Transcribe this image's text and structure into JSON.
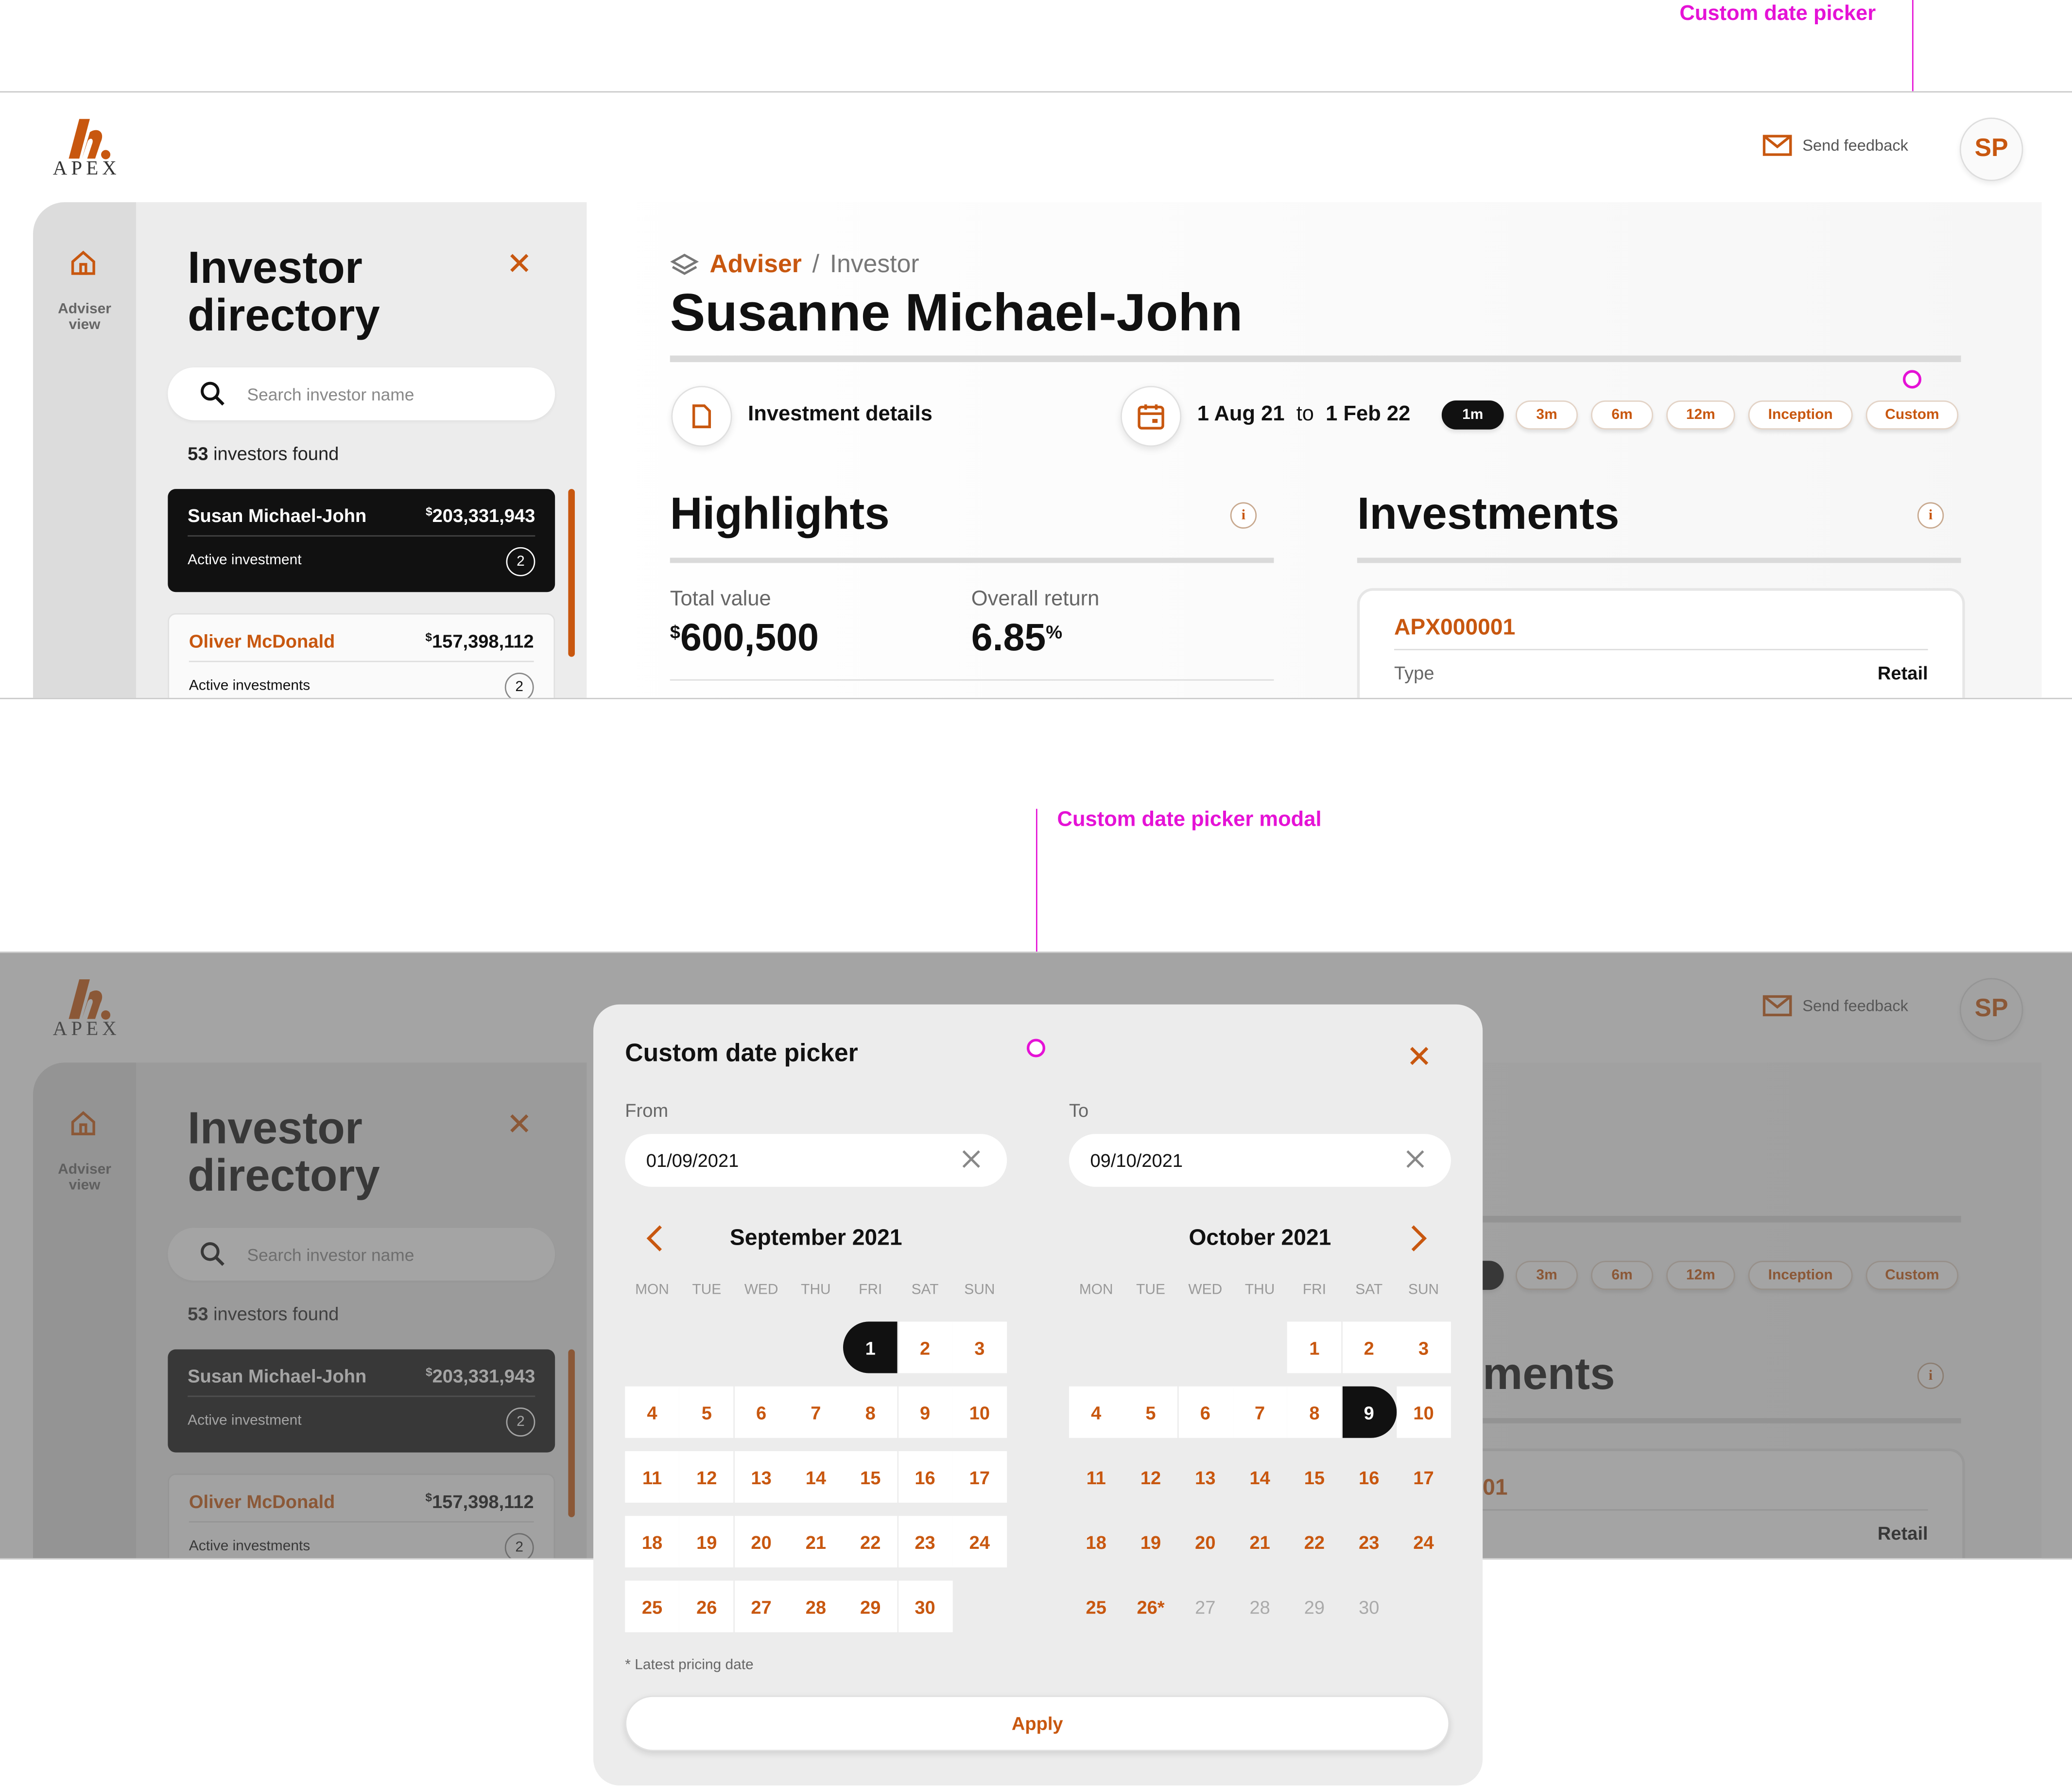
{
  "annotations": {
    "top": "Custom date picker",
    "bottom": "Custom date picker modal"
  },
  "brand": {
    "logo_text": "APEX",
    "accent": "#c8570f"
  },
  "header": {
    "feedback_label": "Send feedback",
    "avatar_initials": "SP"
  },
  "rail": {
    "home_label": "Adviser view"
  },
  "directory": {
    "title": "Investor directory",
    "search_placeholder": "Search investor name",
    "found_count": "53",
    "found_suffix": " investors found",
    "investors": [
      {
        "name": "Susan Michael-John",
        "currency": "$",
        "amount": "203,331,943",
        "status": "Active investment",
        "count": "2"
      },
      {
        "name": "Oliver McDonald",
        "currency": "$",
        "amount": "157,398,112",
        "status": "Active investments",
        "count": "2"
      }
    ]
  },
  "main": {
    "breadcrumb": {
      "adviser": "Adviser",
      "separator": "/",
      "investor": "Investor"
    },
    "investor_name": "Susanne Michael-John",
    "investment_details_label": "Investment details",
    "date_range": {
      "from": "1 Aug 21",
      "to_word": "to",
      "to": "1 Feb 22"
    },
    "periods": [
      "1m",
      "3m",
      "6m",
      "12m",
      "Inception",
      "Custom"
    ],
    "active_period": "1m",
    "highlights": {
      "title": "Highlights",
      "total_value_label": "Total value",
      "total_value_currency": "$",
      "total_value": "600,500",
      "overall_return_label": "Overall return",
      "overall_return": "6.85",
      "overall_return_unit": "%"
    },
    "investments": {
      "title": "Investments",
      "partial_title": "ments",
      "card": {
        "code": "APX000001",
        "partial_code": "01",
        "type_label": "Type",
        "type_value": "Retail"
      }
    }
  },
  "modal": {
    "title": "Custom date picker",
    "from_label": "From",
    "to_label": "To",
    "from_value": "01/09/2021",
    "to_value": "09/10/2021",
    "left_month": "September 2021",
    "right_month": "October 2021",
    "weekdays": [
      "MON",
      "TUE",
      "WED",
      "THU",
      "FRI",
      "SAT",
      "SUN"
    ],
    "footnote": "* Latest pricing date",
    "apply_label": "Apply"
  }
}
